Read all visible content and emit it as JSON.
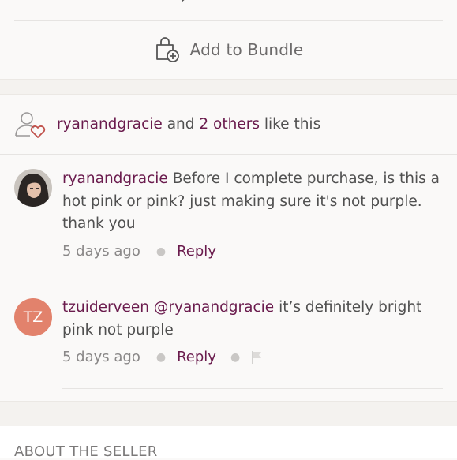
{
  "bundle": {
    "label": "Add to Bundle"
  },
  "likes": {
    "user": "ryanandgracie",
    "connector": " and ",
    "others": "2 others",
    "suffix": " like this"
  },
  "comments": [
    {
      "author": "ryanandgracie",
      "text": " Before I complete purchase,  is this a hot pink or pink? just making sure it's not purple. thank you",
      "time": "5 days ago",
      "reply": "Reply",
      "avatar_type": "photo"
    },
    {
      "author": "tzuiderveen",
      "mention": "@ryanandgracie",
      "text": " it’s definitely bright pink not purple",
      "time": "5 days ago",
      "reply": "Reply",
      "avatar_initials": "TZ",
      "avatar_color": "#e2826c"
    }
  ],
  "seller": {
    "title": "ABOUT THE SELLER"
  },
  "colors": {
    "accent": "#6a1b4d",
    "text": "#505050",
    "muted": "#8a8888"
  },
  "icons": {
    "bundle": "bag-plus-icon",
    "likes": "user-heart-icon",
    "flag": "flag-icon",
    "peek": [
      "heart-icon",
      "comment-icon",
      "share-icon"
    ]
  }
}
